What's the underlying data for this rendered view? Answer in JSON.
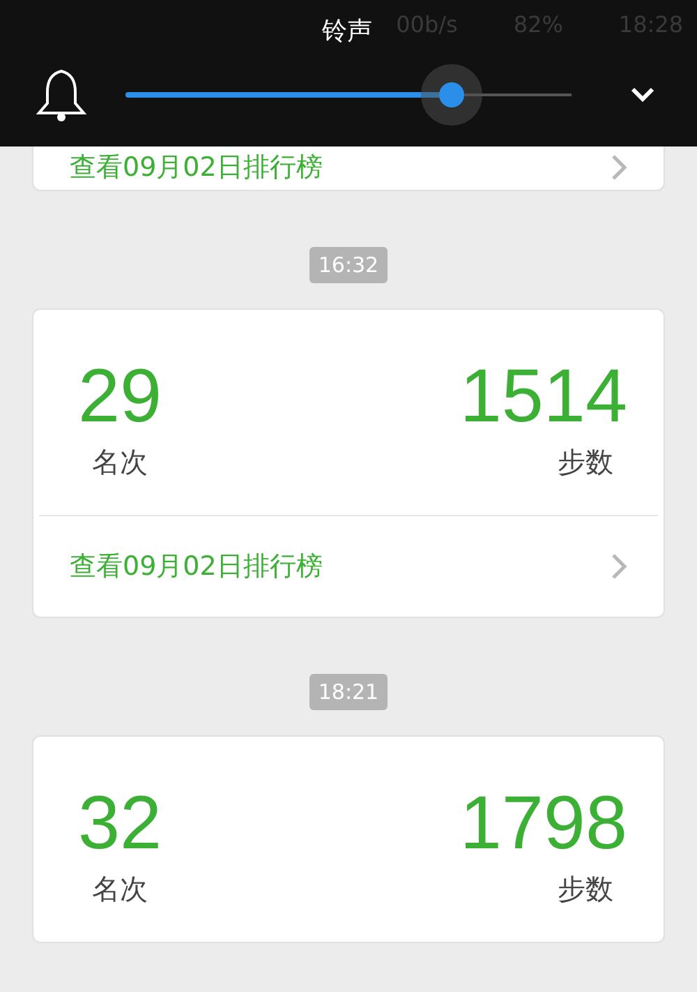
{
  "status_bar": {
    "speed": "00b/s",
    "battery": "82%",
    "time": "18:28"
  },
  "volume_panel": {
    "title": "铃声",
    "level": 0.73
  },
  "feed": [
    {
      "kind": "card",
      "link": "查看09月02日排行榜"
    },
    {
      "kind": "time",
      "time": "16:32"
    },
    {
      "kind": "card",
      "rank": "29",
      "rank_label": "名次",
      "steps": "1514",
      "steps_label": "步数",
      "link": "查看09月02日排行榜"
    },
    {
      "kind": "time",
      "time": "18:21"
    },
    {
      "kind": "card",
      "rank": "32",
      "rank_label": "名次",
      "steps": "1798",
      "steps_label": "步数"
    }
  ]
}
